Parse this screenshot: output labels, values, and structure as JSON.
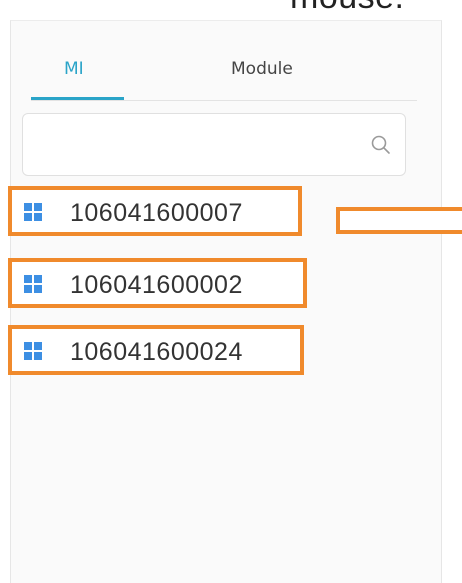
{
  "caption": "mouse.",
  "tabs": [
    {
      "label": "MI",
      "active": true
    },
    {
      "label": "Module",
      "active": false
    }
  ],
  "search": {
    "value": "",
    "placeholder": "",
    "icon": "search-icon"
  },
  "items": [
    {
      "label": "106041600007",
      "icon": "grid-icon"
    },
    {
      "label": "106041600002",
      "icon": "grid-icon"
    },
    {
      "label": "106041600024",
      "icon": "grid-icon"
    }
  ],
  "colors": {
    "accent": "#2aa4c8",
    "highlight": "#f08a2c",
    "grid_icon": "#3d8fe3"
  }
}
